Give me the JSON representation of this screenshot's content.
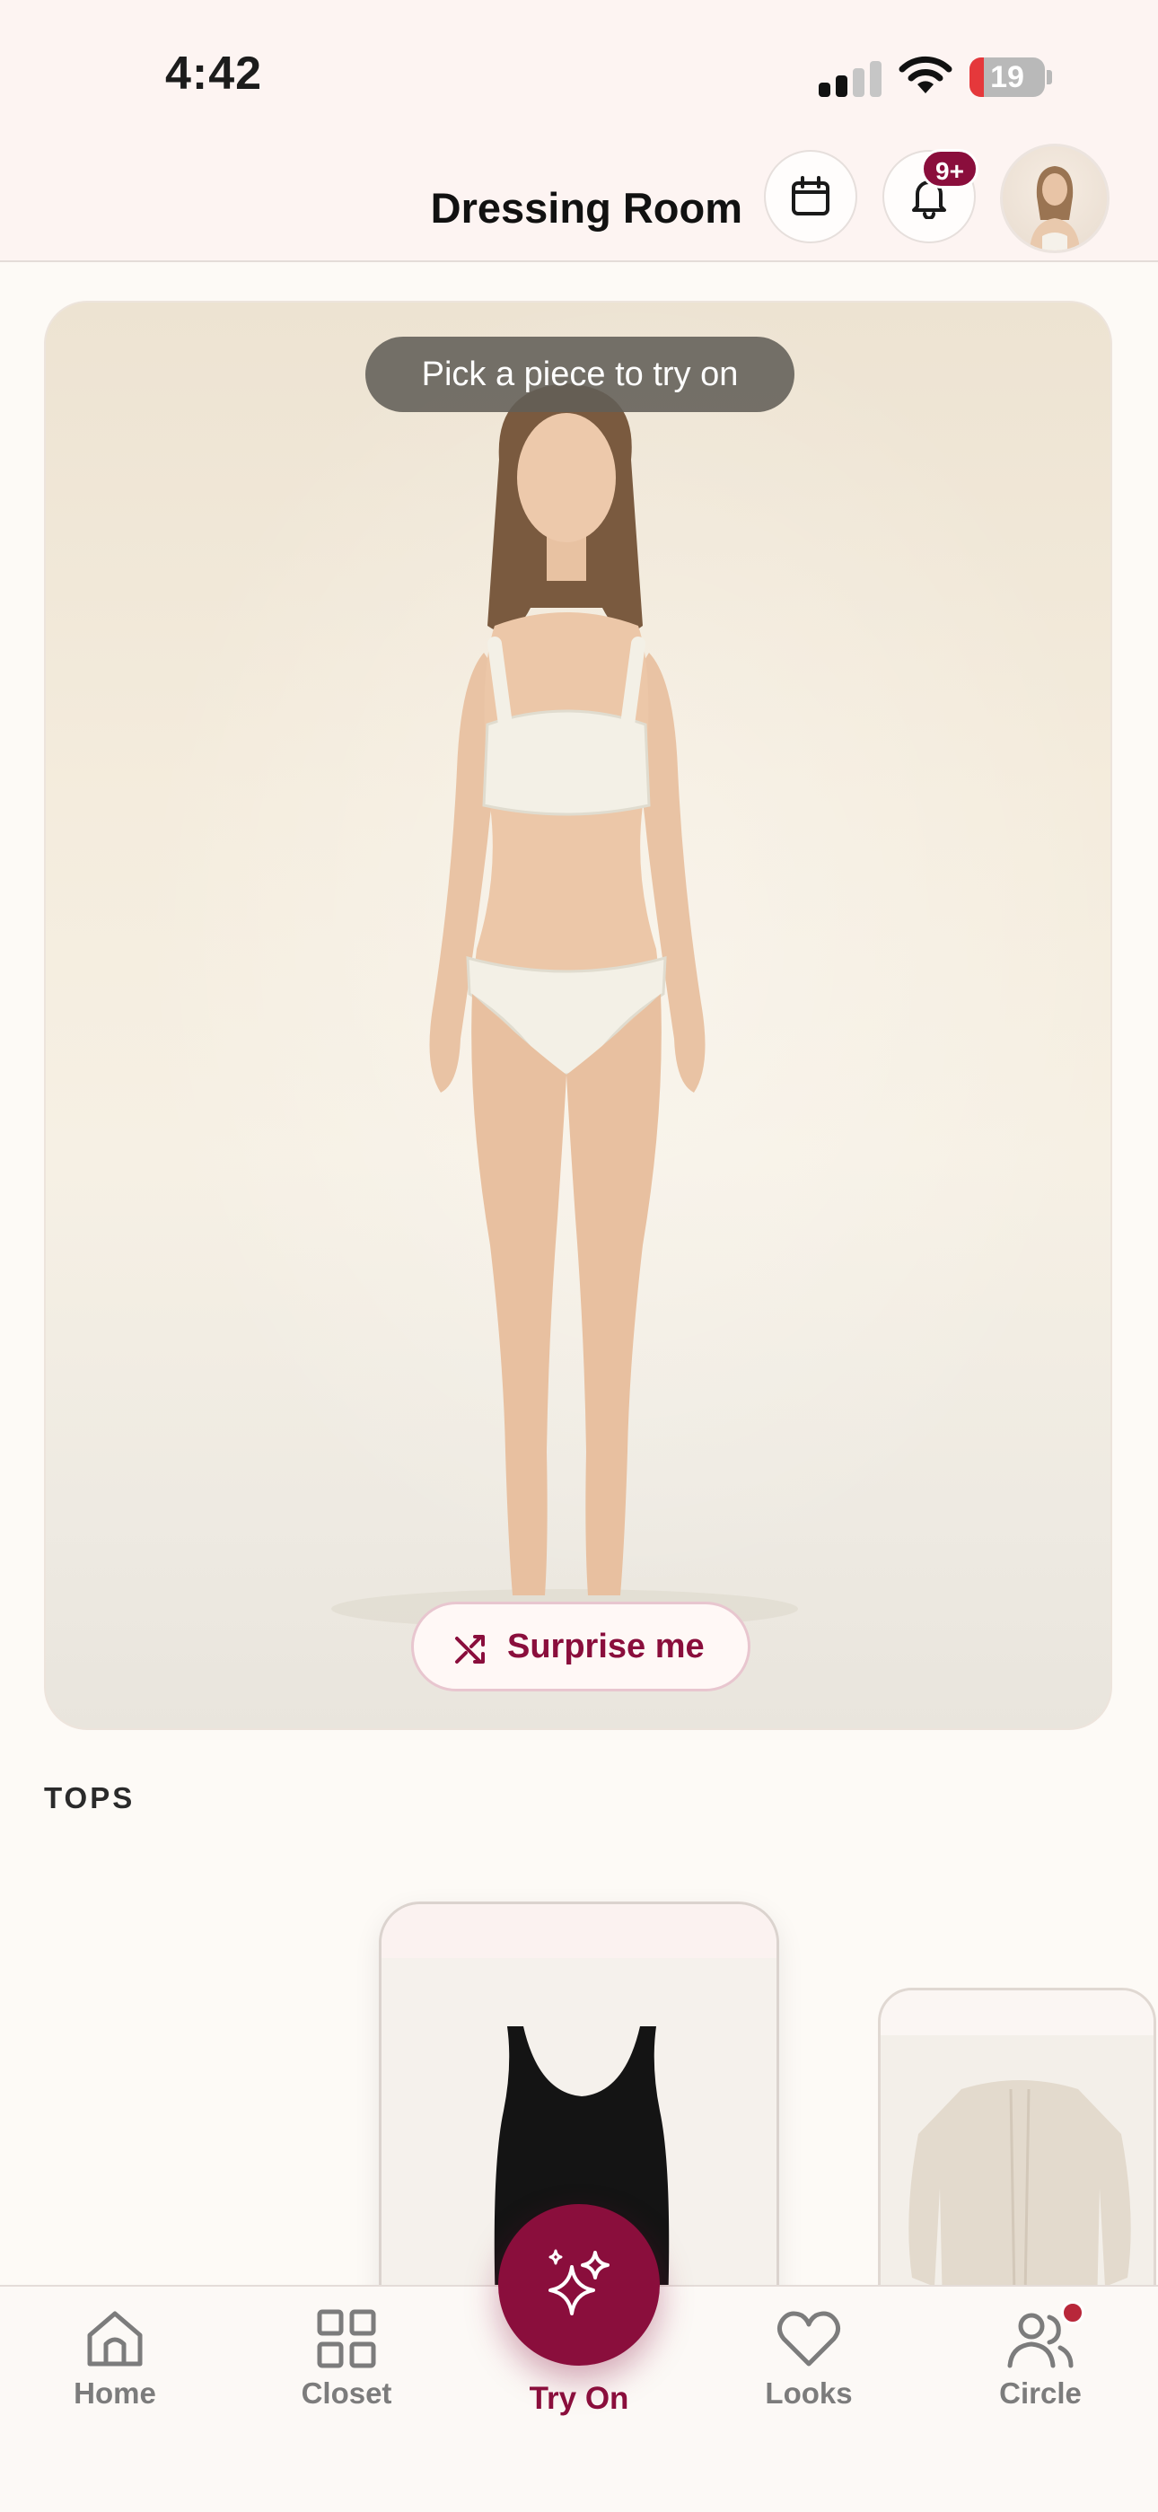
{
  "status_bar": {
    "time": "4:42",
    "battery_level": "19",
    "battery_fraction": 0.19
  },
  "header": {
    "title": "Dressing Room",
    "notification_badge": "9+",
    "icons": [
      "calendar-icon",
      "bell-icon",
      "profile-avatar"
    ]
  },
  "hero": {
    "hint": "Pick a piece to try on",
    "surprise_button": "Surprise me"
  },
  "section": {
    "label": "TOPS"
  },
  "carousel": {
    "items": [
      {
        "name": "black tank top",
        "color": "#141414"
      },
      {
        "name": "cream cardigan",
        "color": "#e3dacd"
      }
    ]
  },
  "tabs": [
    {
      "label": "Home",
      "icon": "home-icon",
      "active": false
    },
    {
      "label": "Closet",
      "icon": "grid-icon",
      "active": false
    },
    {
      "label": "Try On",
      "icon": "sparkles-icon",
      "active": true
    },
    {
      "label": "Looks",
      "icon": "heart-icon",
      "active": false
    },
    {
      "label": "Circle",
      "icon": "people-icon",
      "active": false
    }
  ],
  "colors": {
    "accent": "#8a0e3c",
    "background": "#fdfaf6",
    "header": "#fdf4f2"
  }
}
